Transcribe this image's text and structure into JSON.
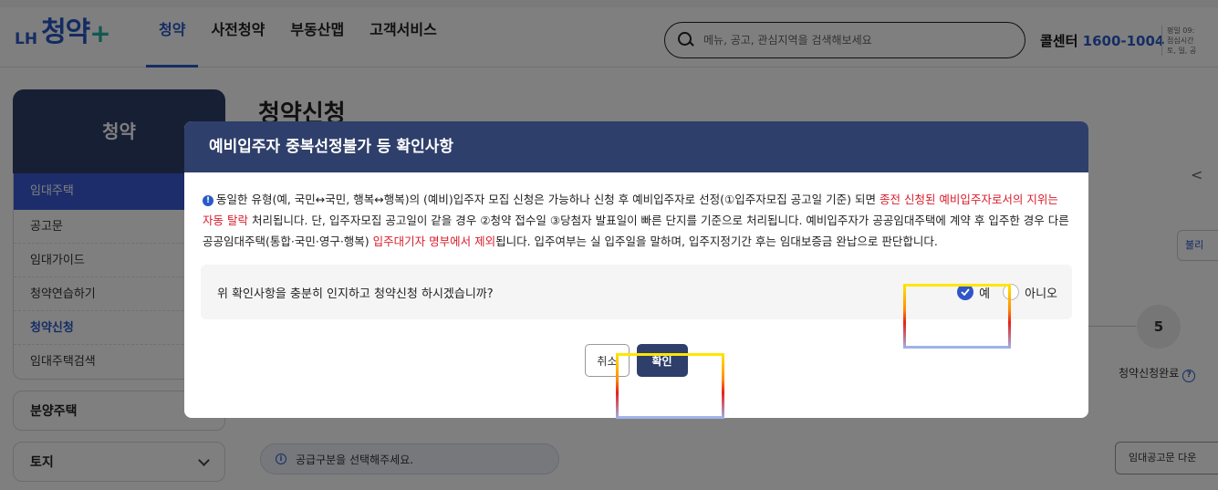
{
  "header": {
    "logo_prefix": "LH",
    "logo_name": "청약",
    "logo_plus": "+",
    "nav": [
      "청약",
      "사전청약",
      "부동산맵",
      "고객서비스"
    ],
    "search_placeholder": "메뉴, 공고, 관심지역을 검색해보세요",
    "callcenter_label": "콜센터",
    "callcenter_number": "1600-1004",
    "hours_line1": "평일 09:",
    "hours_line2": "점심시간",
    "hours_line3": "토, 일, 공"
  },
  "sidebar": {
    "title": "청약",
    "category": "임대주택",
    "links": [
      "공고문",
      "임대가이드",
      "청약연습하기",
      "청약신청",
      "임대주택검색"
    ],
    "active_link": "청약신청",
    "accordion": [
      "분양주택",
      "토지"
    ]
  },
  "page": {
    "title": "청약신청",
    "right_button_1": "불리",
    "step_number": "5",
    "step_label": "청약신청완료",
    "notice_icon": "i",
    "notice": "공급구분을 선택해주세요.",
    "right_button_2": "임대공고문 다운"
  },
  "modal": {
    "title": "예비입주자 중복선정불가 등 확인사항",
    "info_icon": "!",
    "info_part1": "동일한 유형(예, 국민↔국민, 행복↔행복)의 (예비)입주자 모집 신청은 가능하나 신청 후 예비입주자로 선정(①입주자모집 공고일 기준) 되면 ",
    "info_red1": "종전 신청된 예비입주자로서의 지위는 자동 탈락",
    "info_part2": " 처리됩니다. 단, 입주자모집 공고일이 같을 경우 ②청약 접수일 ③당첨자 발표일이 빠른 단지를 기준으로 처리됩니다. 예비입주자가 공공임대주택에 계약 후 입주한 경우 다른 공공임대주택(통합·국민·영구·행복) ",
    "info_red2": "입주대기자 명부에서 제외",
    "info_part3": "됩니다. 입주여부는 실 입주일을 말하며, 입주지정기간 후는 임대보증금 완납으로 판단합니다.",
    "question": "위 확인사항을 충분히 인지하고 청약신청 하시겠습니까?",
    "option_yes": "예",
    "option_no": "아니오",
    "selected": "예",
    "cancel": "취소",
    "confirm": "확인"
  },
  "colors": {
    "brand_navy": "#2f3f6b",
    "brand_blue": "#2b5bc8",
    "alert_red": "#d91c2a",
    "highlight_yellow": "#ffe600"
  }
}
